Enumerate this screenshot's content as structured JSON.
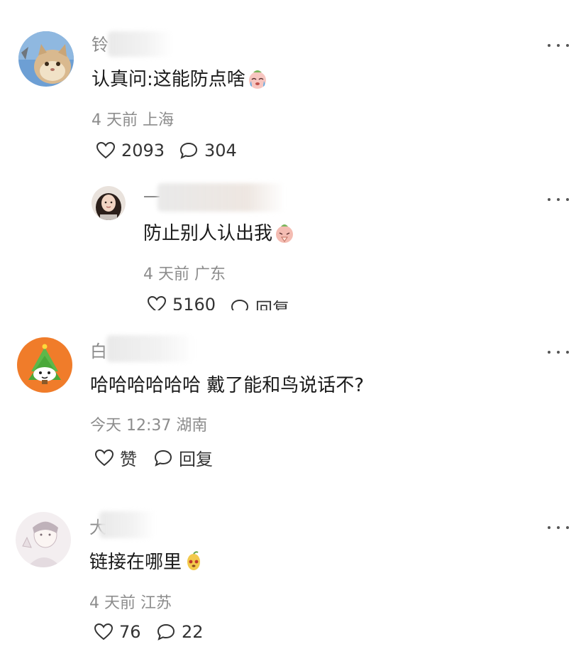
{
  "comments": [
    {
      "name": "铃",
      "text": "认真问:这能防点啥",
      "emoji": "crying-face-icon",
      "time": "4 天前 上海",
      "likes": "2093",
      "replies": "304",
      "reply": {
        "name": "一",
        "text": "防止别人认出我",
        "emoji": "praying-face-icon",
        "time": "4 天前 广东",
        "likes": "5160",
        "replies": "回复"
      }
    },
    {
      "name": "白",
      "text": "哈哈哈哈哈哈 戴了能和鸟说话不?",
      "time": "今天 12:37 湖南",
      "likes": "赞",
      "replies": "回复"
    },
    {
      "name": "大",
      "text": "链接在哪里",
      "emoji": "pear-face-icon",
      "time": "4 天前 江苏",
      "likes": "76",
      "replies": "22"
    }
  ],
  "colors": {
    "text": "#1a1a1a",
    "meta": "#8c8c8c",
    "name": "#8a8a8a"
  }
}
